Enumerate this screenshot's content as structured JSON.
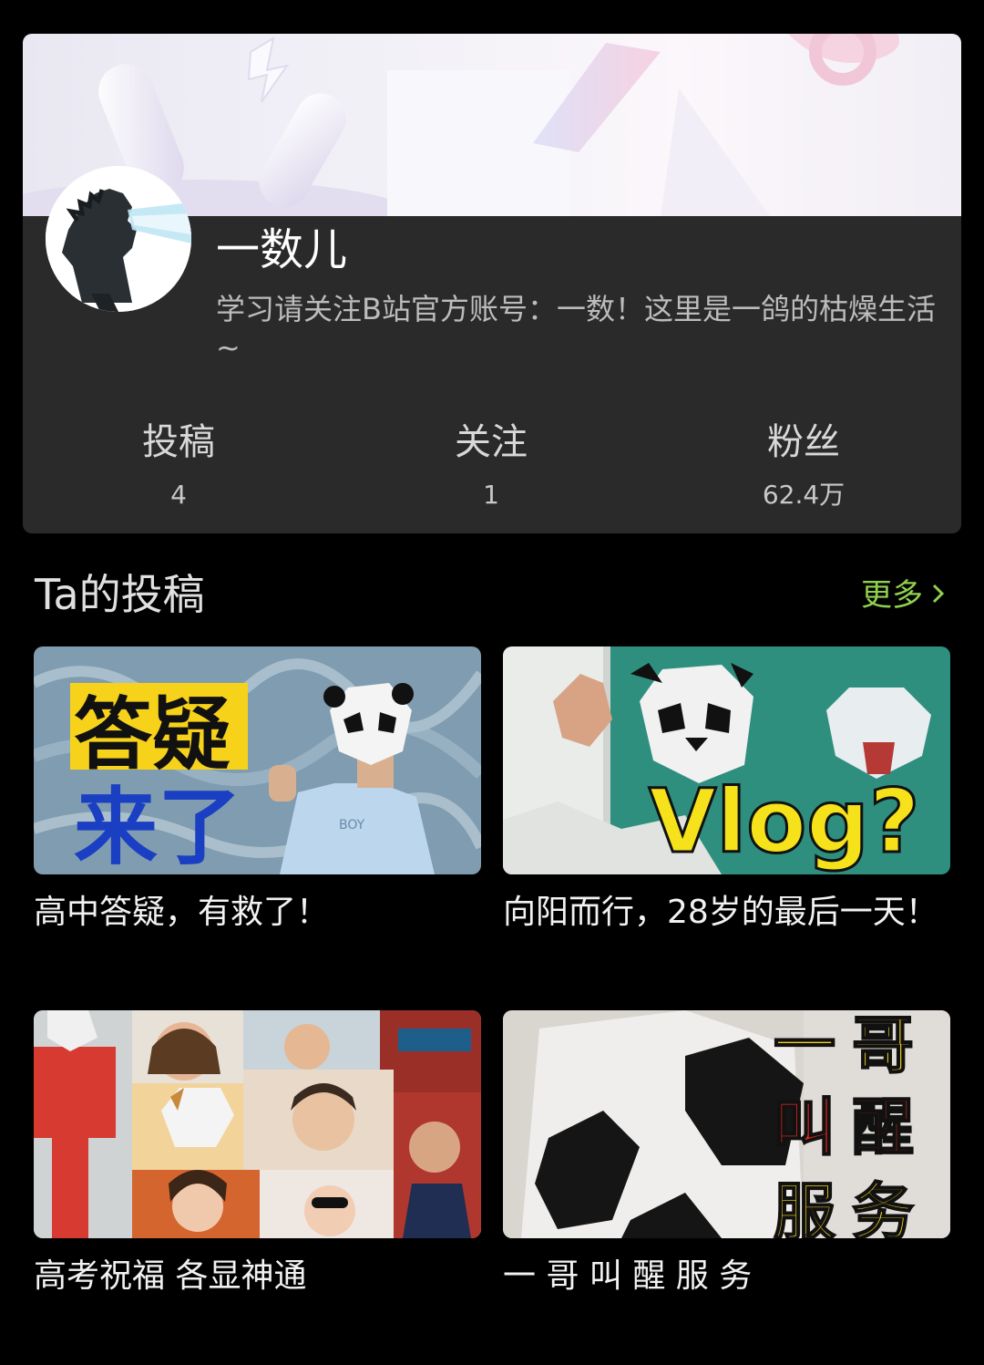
{
  "profile": {
    "username": "一数儿",
    "bio": "学习请关注B站官方账号：一数！这里是一鸽的枯燥生活~"
  },
  "stats": [
    {
      "label": "投稿",
      "value": "4"
    },
    {
      "label": "关注",
      "value": "1"
    },
    {
      "label": "粉丝",
      "value": "62.4万"
    }
  ],
  "section": {
    "title": "Ta的投稿",
    "more_label": "更多"
  },
  "videos": [
    {
      "title": "高中答疑，有救了！",
      "thumb_text_1": "答疑",
      "thumb_text_2": "来了",
      "shirt_text": "BOY"
    },
    {
      "title": "向阳而行，28岁的最后一天！",
      "thumb_text_1": "Vlog?"
    },
    {
      "title": "高考祝福 各显神通"
    },
    {
      "title": "一 哥 叫 醒 服 务",
      "thumb_text_1": "一哥",
      "thumb_text_2": "叫醒",
      "thumb_text_3": "服务"
    }
  ],
  "colors": {
    "accent_green": "#8fd14f",
    "card_bg": "#2a2a2a",
    "page_bg": "#000000"
  }
}
